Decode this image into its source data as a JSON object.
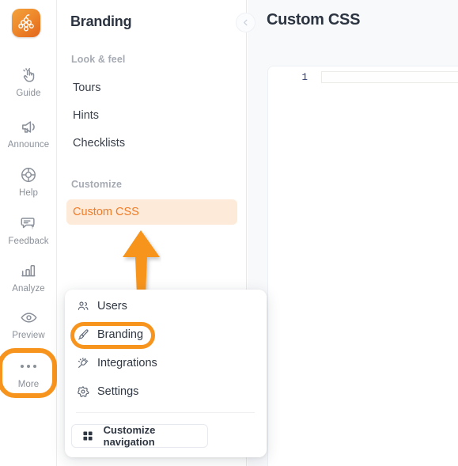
{
  "app": {
    "logo_icon": "grape-cluster-logo",
    "brand_color": "#F7941E"
  },
  "rail": {
    "items": [
      {
        "label": "Guide",
        "icon": "pointing-hand-icon"
      },
      {
        "label": "Announce",
        "icon": "megaphone-icon"
      },
      {
        "label": "Help",
        "icon": "lifebuoy-icon"
      },
      {
        "label": "Feedback",
        "icon": "chat-question-icon"
      },
      {
        "label": "Analyze",
        "icon": "bar-chart-icon"
      },
      {
        "label": "Preview",
        "icon": "eye-icon"
      },
      {
        "label": "More",
        "icon": "ellipsis-icon"
      }
    ],
    "highlighted_item": "More"
  },
  "midpanel": {
    "title": "Branding",
    "collapse_icon": "chevron-left-icon",
    "groups": [
      {
        "section": "Look & feel",
        "items": [
          {
            "label": "Tours",
            "active": false
          },
          {
            "label": "Hints",
            "active": false
          },
          {
            "label": "Checklists",
            "active": false
          }
        ]
      },
      {
        "section": "Customize",
        "items": [
          {
            "label": "Custom CSS",
            "active": true
          }
        ]
      }
    ],
    "active_item": "Custom CSS",
    "active_bg": "#FDEAD9",
    "active_fg": "#F07C28"
  },
  "rightpanel": {
    "title": "Custom CSS",
    "editor": {
      "line_numbers": [
        "1"
      ],
      "content": ""
    }
  },
  "popup": {
    "items": [
      {
        "label": "Users",
        "icon": "users-icon",
        "highlighted": false
      },
      {
        "label": "Branding",
        "icon": "paintbrush-icon",
        "highlighted": true
      },
      {
        "label": "Integrations",
        "icon": "plug-icon",
        "highlighted": false
      },
      {
        "label": "Settings",
        "icon": "gear-icon",
        "highlighted": false
      }
    ],
    "footer_button": {
      "label": "Customize navigation",
      "icon": "grid-squares-icon"
    }
  },
  "annotation": {
    "arrow_icon": "up-arrow-annotation",
    "color": "#F7941E"
  }
}
